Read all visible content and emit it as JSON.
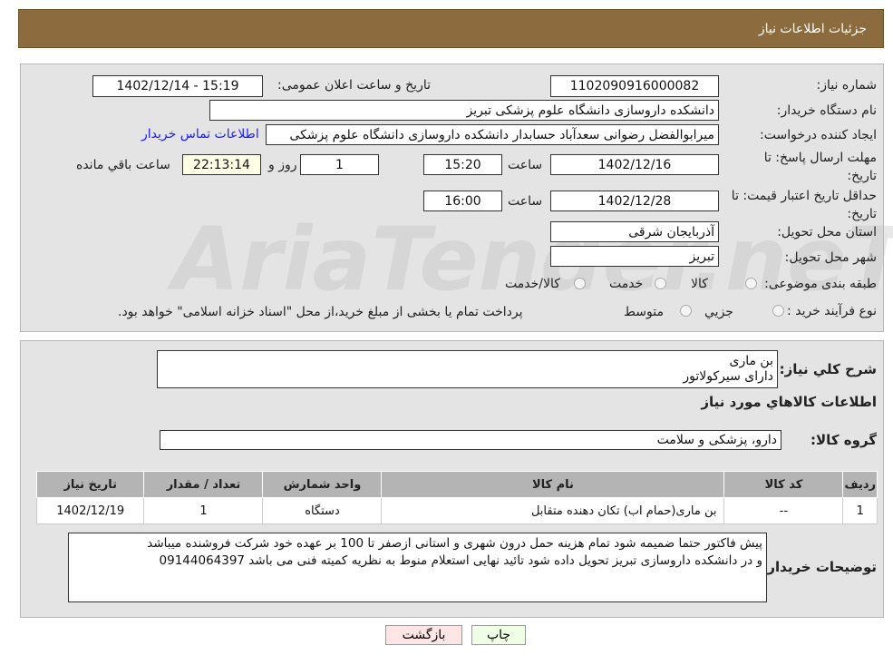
{
  "header": {
    "title": "جزئیات اطلاعات نیاز"
  },
  "watermark": "AriaTender.neT",
  "form": {
    "need_number_label": "شماره نیاز:",
    "need_number": "1102090916000082",
    "announce_label": "تاریخ و ساعت اعلان عمومی:",
    "announce_value": "1402/12/14 - 15:19",
    "buyer_org_label": "نام دستگاه خریدار:",
    "buyer_org": "دانشکده داروسازی دانشگاه علوم پزشکی تبریز",
    "creator_label": "ایجاد کننده درخواست:",
    "creator": "میرابوالفضل رضوانی سعدآباد حسابدار دانشکده داروسازی دانشگاه علوم پزشکی",
    "contact_link": "اطلاعات تماس خریدار",
    "deadline_label": "مهلت ارسال پاسخ: تا تاریخ:",
    "deadline_date": "1402/12/16",
    "time_label": "ساعت",
    "deadline_time": "15:20",
    "days": "1",
    "days_label": "روز و",
    "remaining": "22:13:14",
    "remaining_label": "ساعت باقي مانده",
    "validity_label": "حداقل تاریخ اعتبار قیمت: تا تاریخ:",
    "validity_date": "1402/12/28",
    "validity_time": "16:00",
    "province_label": "استان محل تحویل:",
    "province": "آذربایجان شرقی",
    "city_label": "شهر محل تحویل:",
    "city": "تبریز",
    "category_label": "طبقه بندی موضوعی:",
    "category_options": [
      "کالا",
      "خدمت",
      "کالا/خدمت"
    ],
    "process_label": "نوع فرآیند خرید :",
    "process_options": [
      "جزيي",
      "متوسط"
    ],
    "process_note": "پرداخت تمام یا بخشی از مبلغ خرید،از محل \"اسناد خزانه اسلامی\" خواهد بود."
  },
  "details": {
    "summary_label": "شرح كلي نياز:",
    "summary_lines": [
      "بن ماری",
      "دارای سیرکولاتور"
    ],
    "goods_title": "اطلاعات كالاهاي مورد نياز",
    "group_label": "گروه كالا:",
    "group_value": "دارو، پزشکی و سلامت",
    "table": {
      "headers": [
        "ردیف",
        "کد کالا",
        "نام کالا",
        "واحد شمارش",
        "تعداد / مقدار",
        "تاریخ نیاز"
      ],
      "rows": [
        [
          "1",
          "--",
          "بن ماری(حمام اب) تکان دهنده متقابل",
          "دستگاه",
          "1",
          "1402/12/19"
        ]
      ]
    },
    "notes_label": "توضیحات خریدار:",
    "notes_lines": [
      "پیش فاکتور حتما ضمیمه شود تمام هزینه حمل درون شهری و استانی ازصفر تا 100 بر عهده خود شرکت فروشنده  میباشد",
      "و در دانشکده داروسازی تبریز تحویل داده شود تائید نهایی استعلام منوط به نظریه کمیته فنی می باشد  09144064397"
    ]
  },
  "buttons": {
    "print": "چاپ",
    "back": "بازگشت"
  }
}
